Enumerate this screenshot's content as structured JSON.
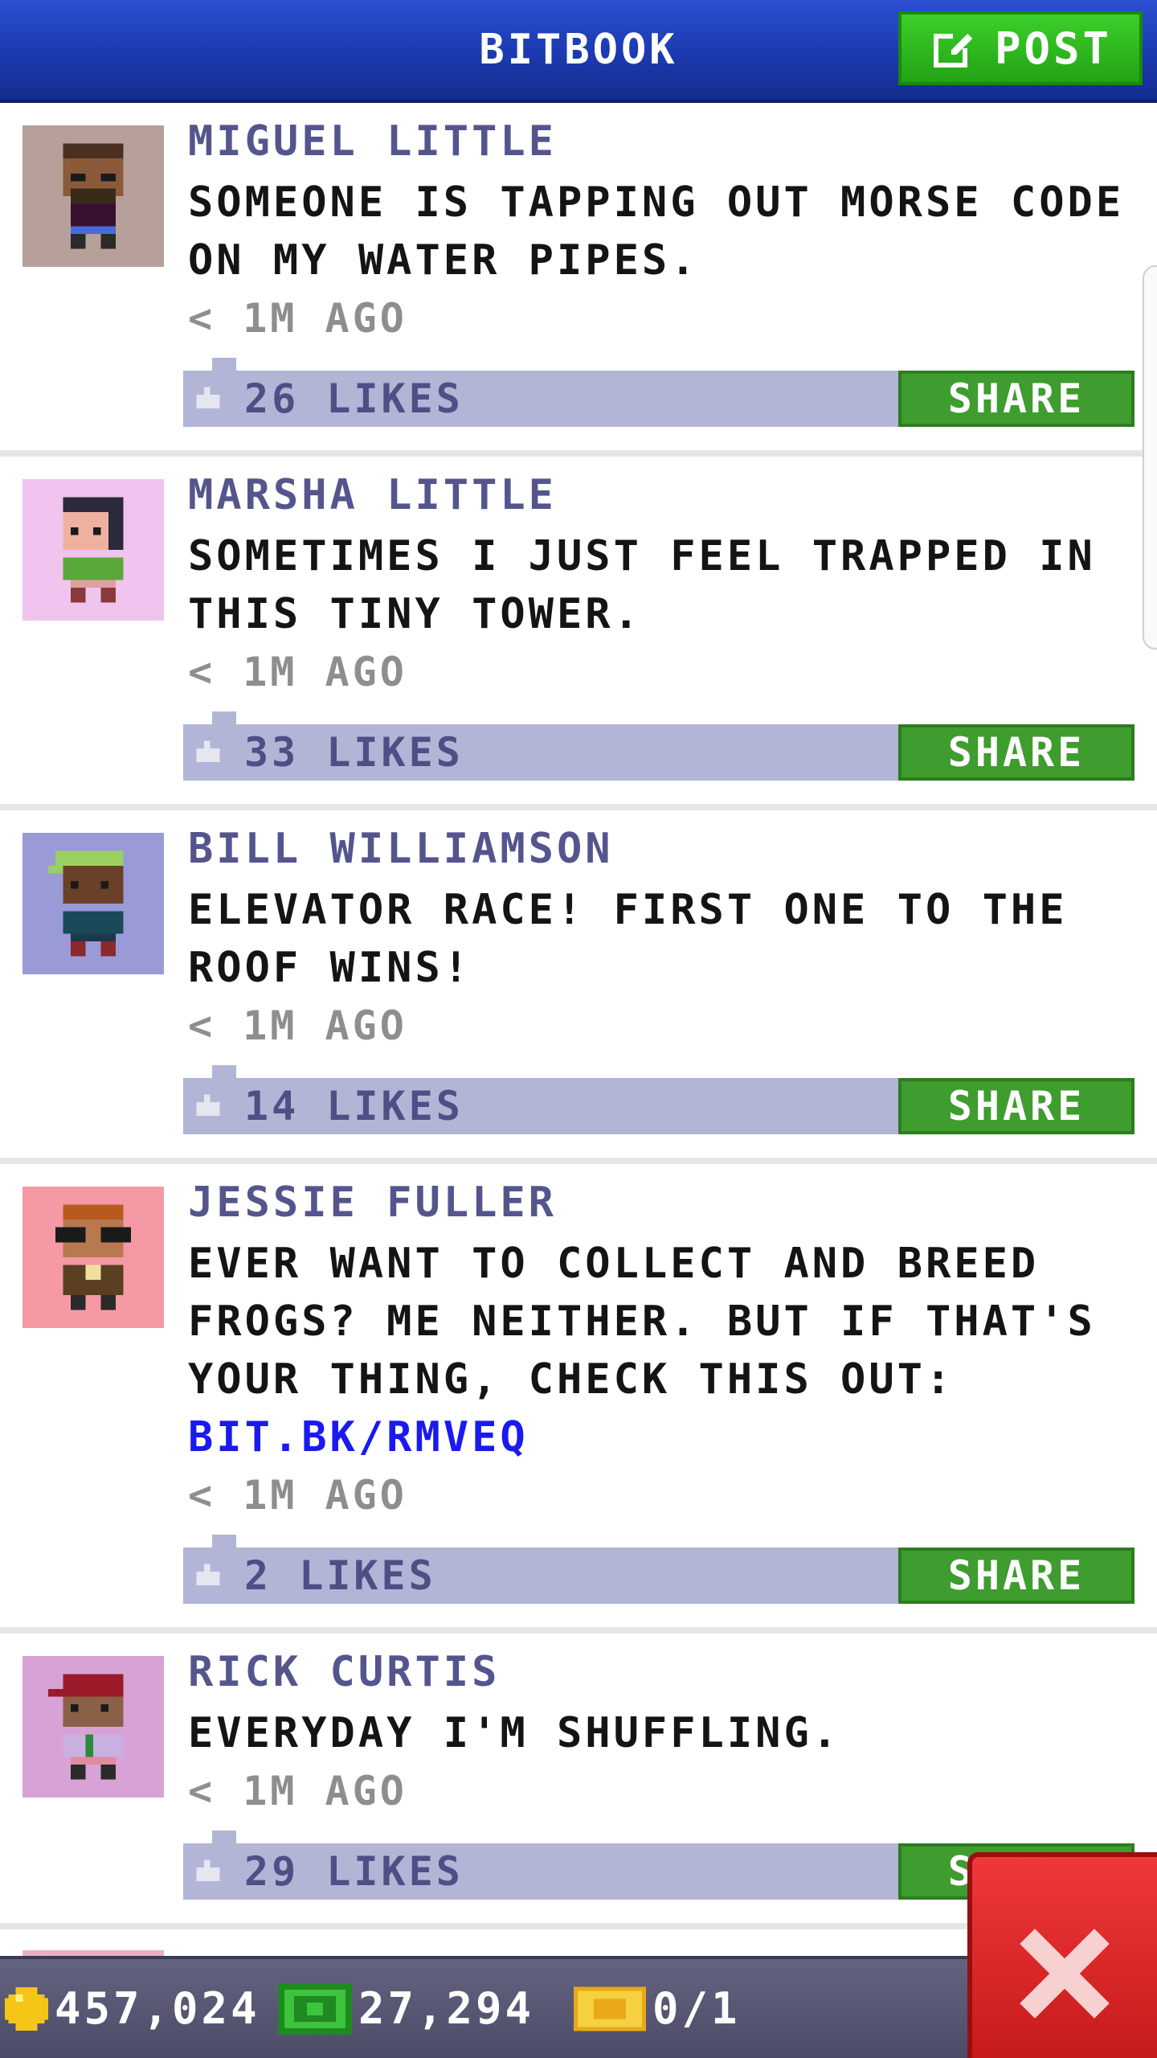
{
  "header": {
    "title": "BITBOOK",
    "post_label": "POST"
  },
  "posts": [
    {
      "author": "MIGUEL LITTLE",
      "text": "SOMEONE IS TAPPING OUT MORSE CODE ON MY WATER PIPES.",
      "link": "",
      "time": "< 1M AGO",
      "likes": "26 LIKES",
      "share_label": "SHARE",
      "avatar_bg": "#b8a09a"
    },
    {
      "author": "MARSHA LITTLE",
      "text": "SOMETIMES I JUST FEEL TRAPPED IN THIS TINY TOWER.",
      "link": "",
      "time": "< 1M AGO",
      "likes": "33 LIKES",
      "share_label": "SHARE",
      "avatar_bg": "#f0c4ef"
    },
    {
      "author": "BILL WILLIAMSON",
      "text": "ELEVATOR RACE! FIRST ONE TO THE ROOF WINS!",
      "link": "",
      "time": "< 1M AGO",
      "likes": "14 LIKES",
      "share_label": "SHARE",
      "avatar_bg": "#9a9ad6"
    },
    {
      "author": "JESSIE FULLER",
      "text": "EVER WANT TO COLLECT AND BREED FROGS? ME NEITHER. BUT IF THAT'S YOUR THING, CHECK THIS OUT:",
      "link": "BIT.BK/RMVEQ",
      "time": "< 1M AGO",
      "likes": "2 LIKES",
      "share_label": "SHARE",
      "avatar_bg": "#f59aa4"
    },
    {
      "author": "RICK CURTIS",
      "text": "EVERYDAY I'M SHUFFLING.",
      "link": "",
      "time": "< 1M AGO",
      "likes": "29 LIKES",
      "share_label": "SHARE",
      "avatar_bg": "#d8a2d6"
    }
  ],
  "status_bar": {
    "coins": "457,024",
    "bux": "27,294",
    "tickets": "0/1"
  },
  "colors": {
    "header": "#1b3ab0",
    "post_button": "#2fbf1f",
    "like_bar": "#b3b5d6",
    "share_button": "#3f9c2f",
    "close_button": "#e22a2c"
  },
  "icons": {
    "post": "edit-icon",
    "like": "thumbs-up-icon",
    "coin": "coin-icon",
    "bux": "bux-icon",
    "ticket": "ticket-icon",
    "close": "close-icon"
  }
}
